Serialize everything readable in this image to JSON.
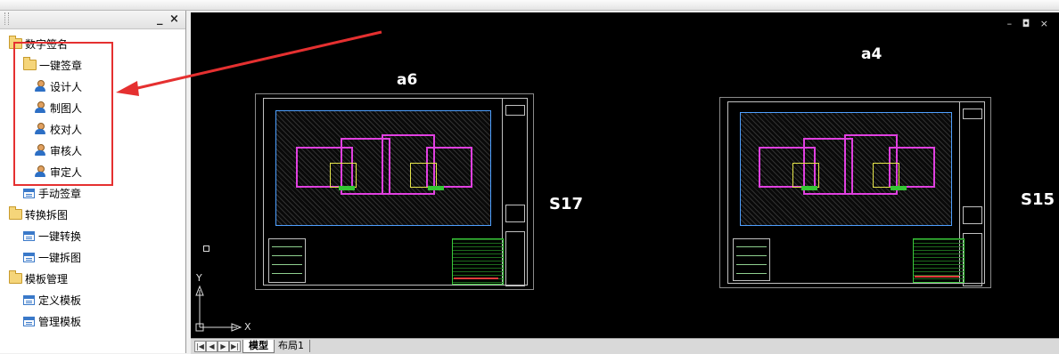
{
  "panel": {
    "minimize_label": "_",
    "close_label": "×",
    "tree": [
      {
        "id": "root-signature",
        "label": "数字签名",
        "icon": "folder-icon"
      },
      {
        "id": "one-click-sign",
        "label": "一键签章",
        "icon": "folder-icon"
      },
      {
        "id": "designer",
        "label": "设计人",
        "icon": "person-icon"
      },
      {
        "id": "drafter",
        "label": "制图人",
        "icon": "person-icon"
      },
      {
        "id": "checker",
        "label": "校对人",
        "icon": "person-icon"
      },
      {
        "id": "reviewer",
        "label": "审核人",
        "icon": "person-icon"
      },
      {
        "id": "approver",
        "label": "审定人",
        "icon": "person-icon"
      },
      {
        "id": "manual-sign",
        "label": "手动签章",
        "icon": "window-icon"
      },
      {
        "id": "convert-split",
        "label": "转换拆图",
        "icon": "folder-icon"
      },
      {
        "id": "one-click-convert",
        "label": "一键转换",
        "icon": "window-icon"
      },
      {
        "id": "one-click-split",
        "label": "一键拆图",
        "icon": "window-icon"
      },
      {
        "id": "template-mgmt",
        "label": "模板管理",
        "icon": "folder-icon"
      },
      {
        "id": "define-template",
        "label": "定义模板",
        "icon": "window-icon"
      },
      {
        "id": "manage-template",
        "label": "管理模板",
        "icon": "window-icon"
      }
    ]
  },
  "drawing": {
    "window_controls": "– ◘ ×",
    "labels": {
      "sheet_left_name": "a6",
      "sheet_right_name": "a4",
      "sheet_left_code": "S17",
      "sheet_right_code": "S15"
    },
    "ucs": {
      "y": "Y",
      "x": "X"
    }
  },
  "tabs": {
    "nav": [
      "|◀",
      "◀",
      "▶",
      "▶|"
    ],
    "items": [
      {
        "label": "模型",
        "active": true
      },
      {
        "label": "布局1",
        "active": false
      }
    ]
  },
  "colors": {
    "annotation_red": "#e53030",
    "canvas_bg": "#000000",
    "wall_magenta": "#e040e0",
    "dim_cyan": "#4fa0ff"
  }
}
